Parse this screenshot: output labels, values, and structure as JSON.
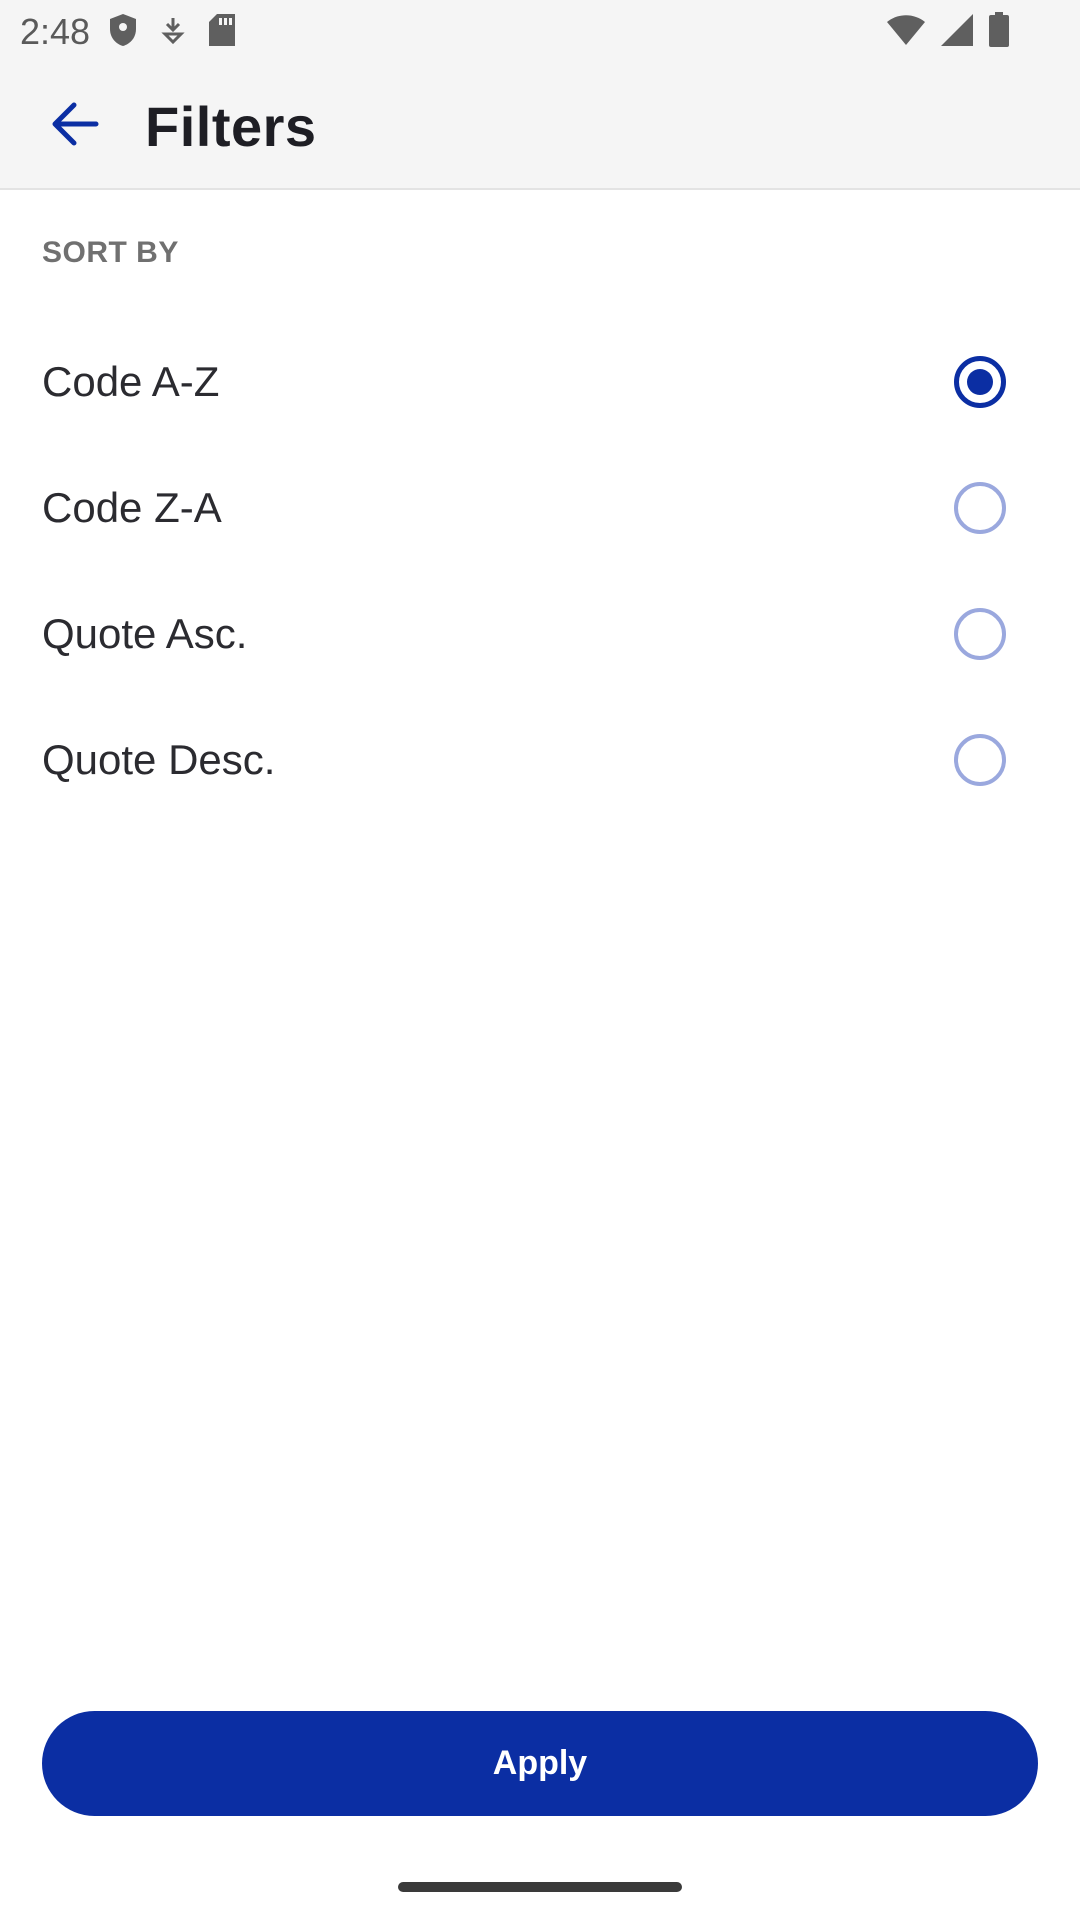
{
  "status_bar": {
    "time": "2:48",
    "icons_left": [
      "shield-icon",
      "download-icon",
      "sd-card-icon"
    ],
    "icons_right": [
      "wifi-icon",
      "signal-icon",
      "battery-icon"
    ]
  },
  "app_bar": {
    "back_icon": "arrow-back-icon",
    "title": "Filters"
  },
  "sort": {
    "header": "SORT BY",
    "options": [
      {
        "label": "Code A-Z",
        "selected": true
      },
      {
        "label": "Code Z-A",
        "selected": false
      },
      {
        "label": "Quote Asc.",
        "selected": false
      },
      {
        "label": "Quote Desc.",
        "selected": false
      }
    ]
  },
  "footer": {
    "apply_label": "Apply"
  },
  "colors": {
    "accent": "#0b2ea3",
    "radio_unselected": "#9aa8de",
    "app_bar_bg": "#f5f5f5",
    "title_text": "#1e1e24",
    "section_header_text": "#707070"
  }
}
